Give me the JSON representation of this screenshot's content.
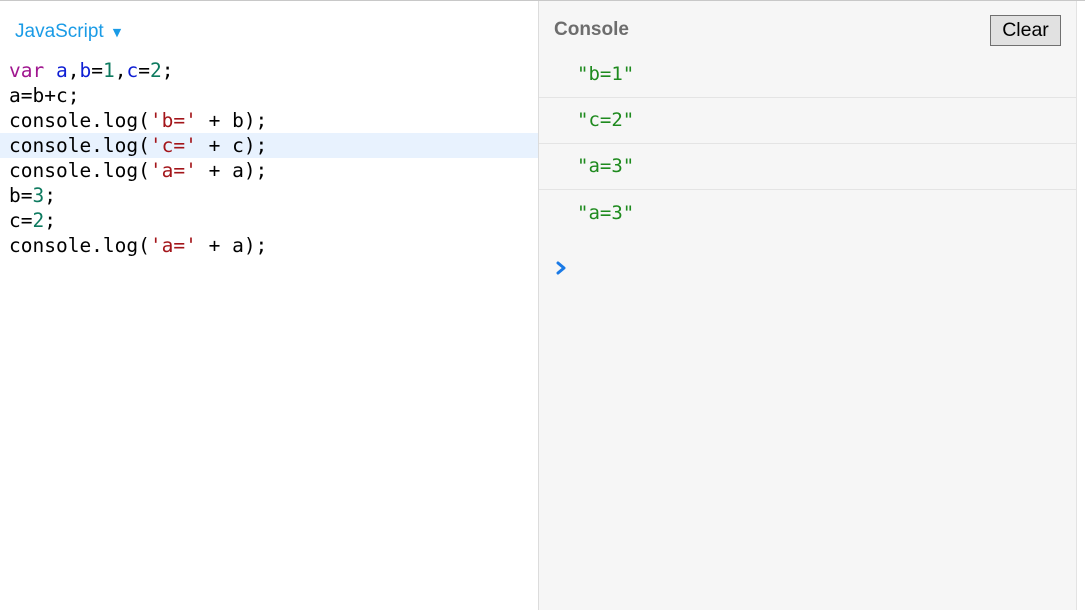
{
  "editor": {
    "language": "JavaScript",
    "lines": [
      [
        {
          "t": "var",
          "c": "kw"
        },
        {
          "t": " "
        },
        {
          "t": "a",
          "c": "var"
        },
        {
          "t": ","
        },
        {
          "t": "b",
          "c": "var"
        },
        {
          "t": "="
        },
        {
          "t": "1",
          "c": "num"
        },
        {
          "t": ","
        },
        {
          "t": "c",
          "c": "var"
        },
        {
          "t": "="
        },
        {
          "t": "2",
          "c": "num"
        },
        {
          "t": ";"
        }
      ],
      [
        {
          "t": "a=b+c;"
        }
      ],
      [
        {
          "t": "console.log("
        },
        {
          "t": "'b='",
          "c": "str"
        },
        {
          "t": " + b);"
        }
      ],
      [
        {
          "t": "console.log("
        },
        {
          "t": "'c='",
          "c": "str"
        },
        {
          "t": " + c);"
        }
      ],
      [
        {
          "t": "console.log("
        },
        {
          "t": "'a='",
          "c": "str"
        },
        {
          "t": " + a);"
        }
      ],
      [
        {
          "t": "b="
        },
        {
          "t": "3",
          "c": "num"
        },
        {
          "t": ";"
        }
      ],
      [
        {
          "t": "c="
        },
        {
          "t": "2",
          "c": "num"
        },
        {
          "t": ";"
        }
      ],
      [
        {
          "t": "console.log("
        },
        {
          "t": "'a='",
          "c": "str"
        },
        {
          "t": " + a);"
        }
      ]
    ],
    "active_line": 3
  },
  "console": {
    "title": "Console",
    "clear_label": "Clear",
    "logs": [
      "\"b=1\"",
      "\"c=2\"",
      "\"a=3\"",
      "\"a=3\""
    ]
  },
  "colors": {
    "accent": "#1a9be6",
    "log_string": "#1e8a1e",
    "prompt": "#1a7ae6"
  },
  "icons": {
    "language_dropdown": "triangle-down-icon",
    "prompt": "chevron-right-icon"
  }
}
